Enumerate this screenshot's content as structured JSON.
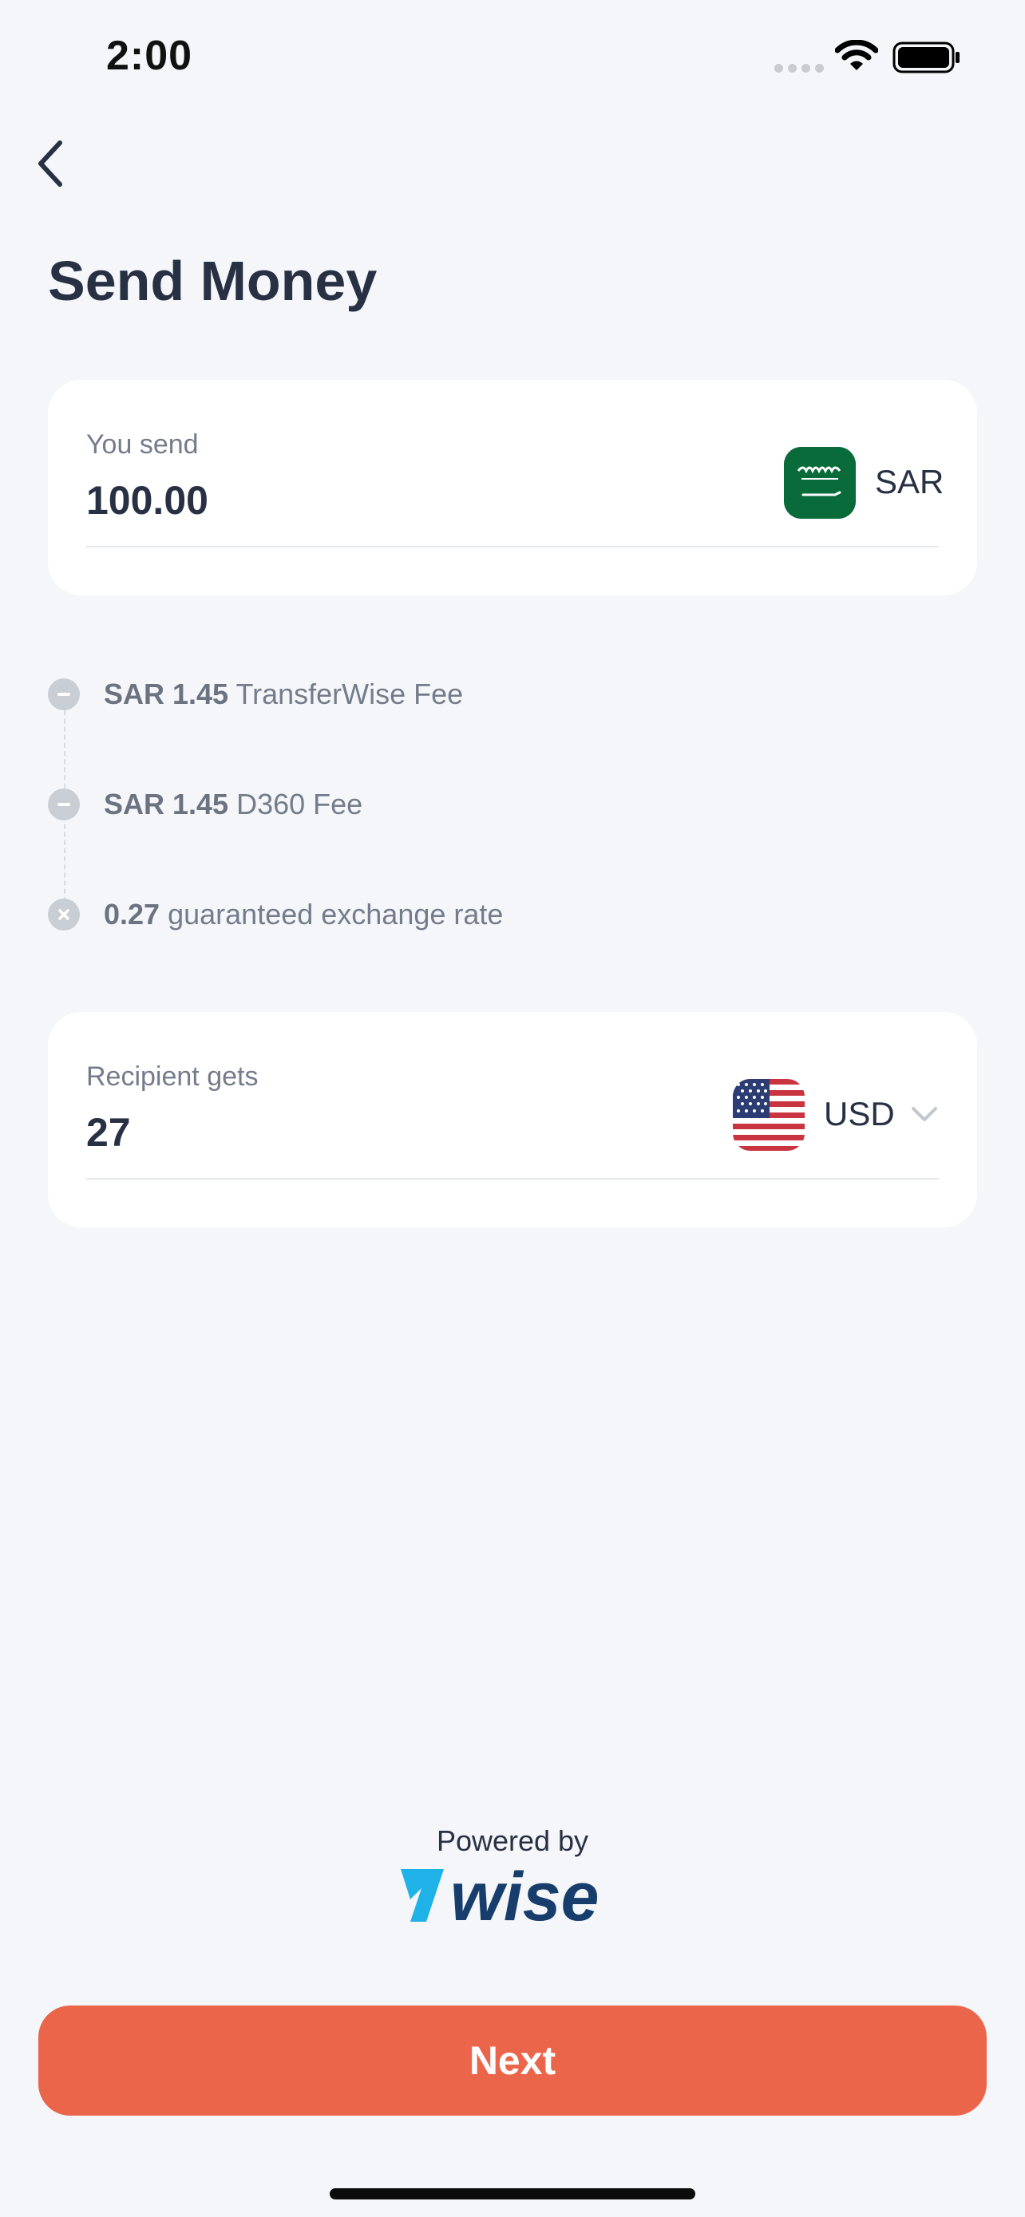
{
  "status_bar": {
    "time": "2:00"
  },
  "header": {
    "title": "Send Money"
  },
  "send": {
    "label": "You send",
    "amount": "100.00",
    "currency": "SAR"
  },
  "fees": [
    {
      "amount": "SAR 1.45",
      "description": "TransferWise Fee",
      "icon": "minus-icon"
    },
    {
      "amount": "SAR 1.45",
      "description": "D360 Fee",
      "icon": "minus-icon"
    },
    {
      "amount": "0.27",
      "description": "guaranteed exchange rate",
      "icon": "multiply-icon"
    }
  ],
  "receive": {
    "label": "Recipient gets",
    "amount": "27",
    "currency": "USD"
  },
  "branding": {
    "powered_by": "Powered by",
    "brand": "wise"
  },
  "footer": {
    "next_label": "Next"
  },
  "colors": {
    "accent": "#eb654b",
    "background": "#f4f6f9",
    "text": "#283144",
    "brand_blue": "#163d6b",
    "brand_cyan": "#1fb2e8"
  }
}
